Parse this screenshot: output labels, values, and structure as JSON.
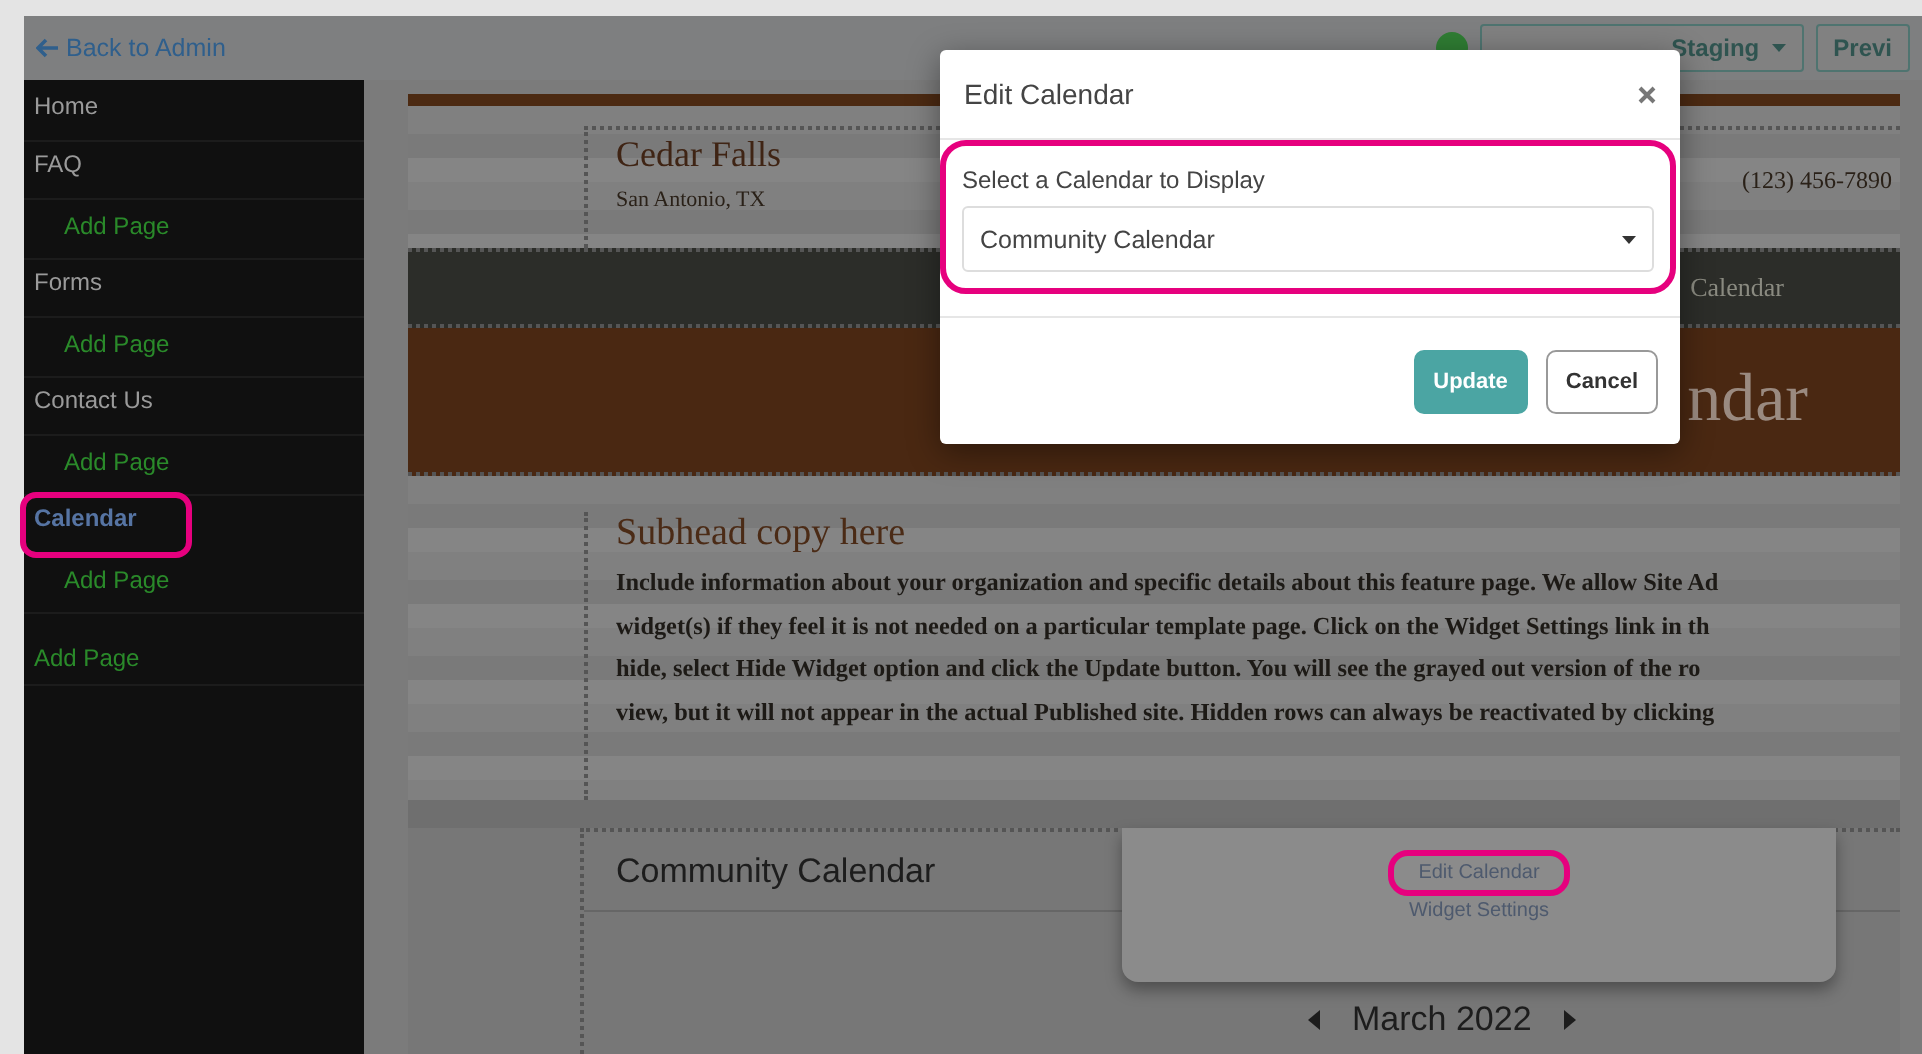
{
  "top_bar": {
    "back_link": "Back to Admin",
    "editing_dropdown": "Staging",
    "preview_button": "Previ"
  },
  "sidebar": {
    "items": [
      {
        "label": "Home",
        "selected": false,
        "highlighted": false
      },
      {
        "label": "FAQ",
        "selected": false,
        "highlighted": false,
        "children": [
          {
            "label": "Add Page"
          }
        ]
      },
      {
        "label": "Forms",
        "selected": false,
        "highlighted": false,
        "children": [
          {
            "label": "Add Page"
          }
        ]
      },
      {
        "label": "Contact Us",
        "selected": false,
        "highlighted": false,
        "children": [
          {
            "label": "Add Page"
          }
        ]
      },
      {
        "label": "Calendar",
        "selected": true,
        "highlighted": true,
        "children": [
          {
            "label": "Add Page"
          }
        ]
      }
    ],
    "add_page": "Add Page"
  },
  "page_preview": {
    "site_name": "Cedar Falls",
    "location": "San Antonio, TX",
    "phone": "(123) 456-7890",
    "nav_item": "Calendar",
    "banner_title": "ndar",
    "subhead": "Subhead copy here",
    "body_lines": [
      "Include information about your organization and specific details about this feature page. We allow Site Ad",
      "widget(s) if they feel it is not needed on a particular template page. Click on the Widget Settings link in th",
      "hide, select Hide Widget option and click the Update button. You will see the grayed out version of the ro",
      "view, but it will not appear in the actual Published site. Hidden rows can always be reactivated by clicking"
    ],
    "widget": {
      "title": "Community Calendar",
      "menu": [
        {
          "label": "Edit Calendar",
          "highlighted": true
        },
        {
          "label": "Widget Settings",
          "highlighted": false
        }
      ],
      "month": "March 2022"
    }
  },
  "modal": {
    "title": "Edit Calendar",
    "field_label": "Select a Calendar to Display",
    "select_value": "Community Calendar",
    "highlighted": true,
    "buttons": [
      {
        "label": "Update",
        "kind": "primary"
      },
      {
        "label": "Cancel",
        "kind": "secondary"
      }
    ]
  }
}
